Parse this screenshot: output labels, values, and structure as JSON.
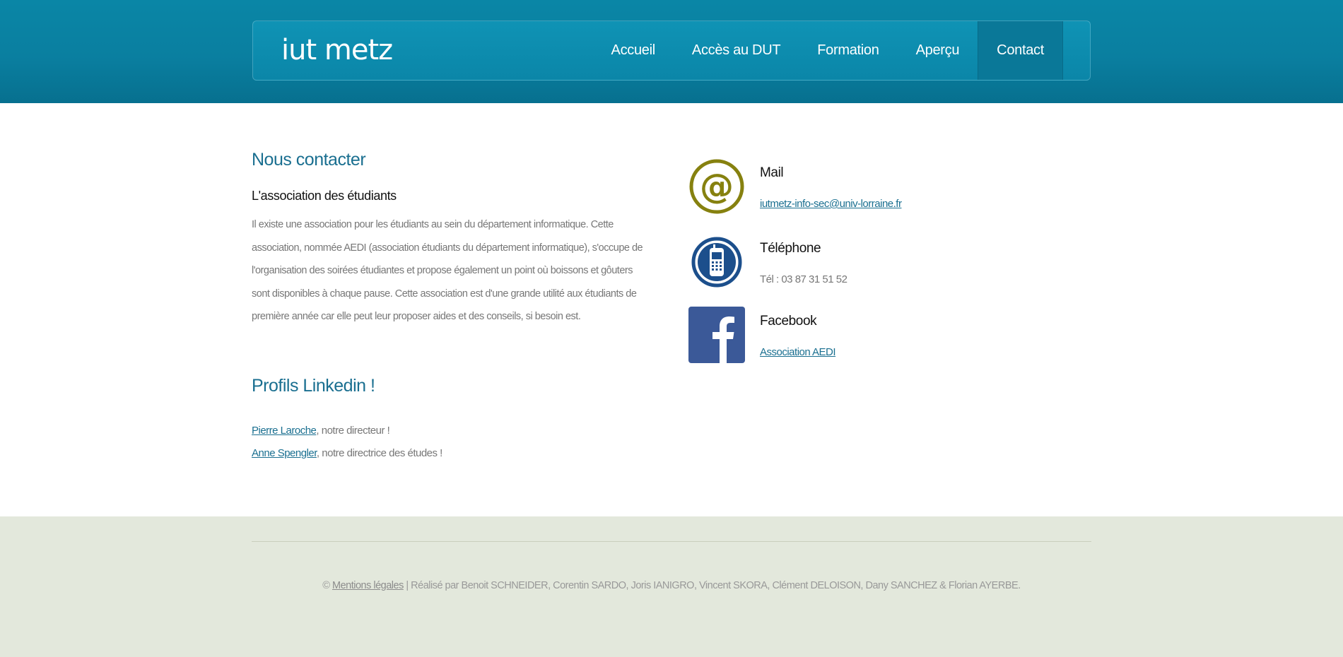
{
  "header": {
    "logo": "iut metz",
    "nav": [
      {
        "label": "Accueil"
      },
      {
        "label": "Accès au DUT"
      },
      {
        "label": "Formation"
      },
      {
        "label": "Aperçu"
      },
      {
        "label": "Contact"
      }
    ],
    "active_index": 4
  },
  "contact_section": {
    "title": "Nous contacter",
    "subtitle": "L'association des étudiants",
    "paragraph": "Il existe une association pour les étudiants au sein du département informatique. Cette association, nommée AEDI (association étudiants du département informatique), s'occupe de l'organisation des soirées étudiantes et propose également un point où boissons et gôuters sont disponibles à chaque pause. Cette association est d'une grande utilité aux étudiants de première année car elle peut leur proposer aides et des conseils, si besoin est."
  },
  "linkedin": {
    "title": "Profils Linkedin !",
    "profiles": [
      {
        "name": "Pierre Laroche",
        "suffix": ", notre directeur !"
      },
      {
        "name": "Anne Spengler",
        "suffix": ", notre directrice des études !"
      }
    ]
  },
  "contacts": {
    "mail": {
      "label": "Mail",
      "value": "iutmetz-info-sec@univ-lorraine.fr",
      "icon": "at-icon",
      "color": "#86810f"
    },
    "phone": {
      "label": "Téléphone",
      "value": "Tél : 03 87 31 51 52",
      "icon": "mobile-phone-icon",
      "color": "#1c4f8c"
    },
    "facebook": {
      "label": "Facebook",
      "value": "Association AEDI",
      "icon": "facebook-icon",
      "color": "#3b5998"
    }
  },
  "footer": {
    "copyright": "©",
    "legal_link": "Mentions légales",
    "credits": "| Réalisé par Benoit SCHNEIDER, Corentin SARDO, Joris IANIGRO, Vincent SKORA, Clément DELOISON, Dany SANCHEZ & Florian AYERBE."
  }
}
